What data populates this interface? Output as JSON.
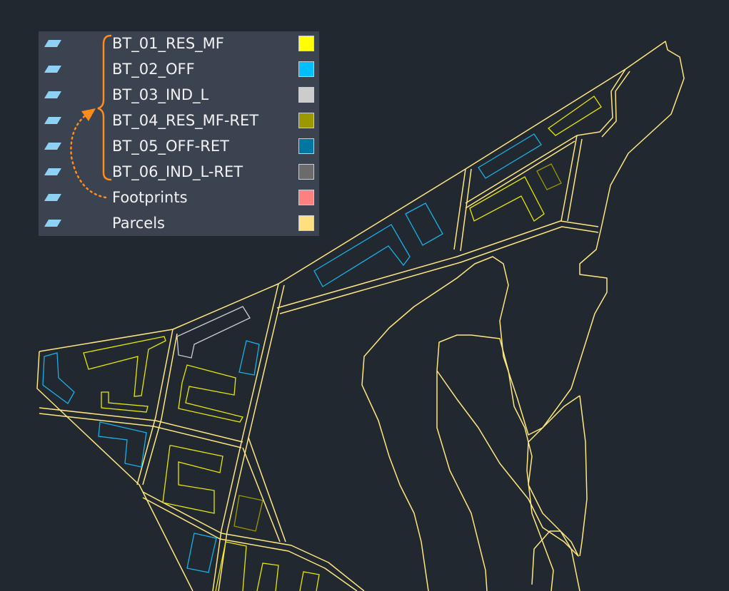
{
  "legend": {
    "layers": [
      {
        "name": "BT_01_RES_MF",
        "color": "#ffff00",
        "icon": "layer-icon"
      },
      {
        "name": "BT_02_OFF",
        "color": "#00bfff",
        "icon": "layer-icon"
      },
      {
        "name": "BT_03_IND_L",
        "color": "#cccccc",
        "icon": "layer-icon"
      },
      {
        "name": "BT_04_RES_MF-RET",
        "color": "#9a9a00",
        "icon": "layer-icon"
      },
      {
        "name": "BT_05_OFF-RET",
        "color": "#0077a0",
        "icon": "layer-icon"
      },
      {
        "name": "BT_06_IND_L-RET",
        "color": "#6b6b6b",
        "icon": "layer-icon"
      },
      {
        "name": "Footprints",
        "color": "#ff8080",
        "icon": "layer-icon"
      },
      {
        "name": "Parcels",
        "color": "#ffdf80",
        "icon": "layer-icon"
      }
    ]
  },
  "colors": {
    "background": "#212830",
    "legend_panel": "#3b4250",
    "parcel_line": "#ffe680",
    "annotation": "#ff8c1a",
    "layer_icon": "#8fd0f5"
  }
}
